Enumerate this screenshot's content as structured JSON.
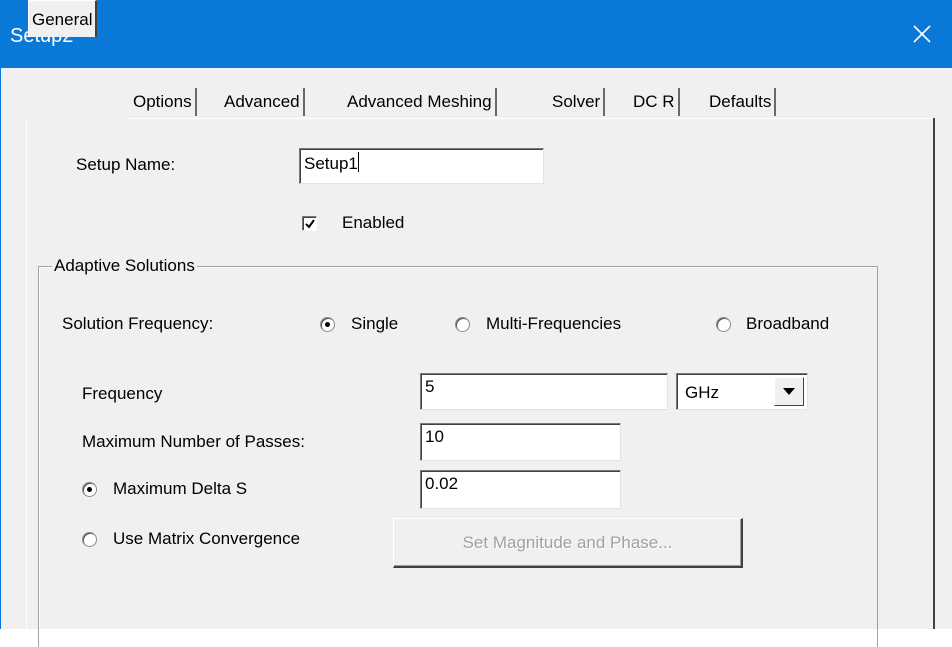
{
  "window": {
    "title": "Setup2",
    "accent_color": "#0a78d7"
  },
  "tabs": [
    {
      "label": "General",
      "active": true
    },
    {
      "label": "Options",
      "active": false
    },
    {
      "label": "Advanced",
      "active": false
    },
    {
      "label": "Advanced Meshing",
      "active": false
    },
    {
      "label": "Solver",
      "active": false
    },
    {
      "label": "DC R",
      "active": false
    },
    {
      "label": "Defaults",
      "active": false
    }
  ],
  "general": {
    "setup_name_label": "Setup Name:",
    "setup_name_value": "Setup1",
    "enabled_label": "Enabled",
    "enabled_checked": true
  },
  "adaptive": {
    "group_label": "Adaptive Solutions",
    "solution_frequency_label": "Solution Frequency:",
    "freq_options": [
      {
        "label": "Single",
        "selected": true
      },
      {
        "label": "Multi-Frequencies",
        "selected": false
      },
      {
        "label": "Broadband",
        "selected": false
      }
    ],
    "frequency_label": "Frequency",
    "frequency_value": "5",
    "frequency_unit": "GHz",
    "max_passes_label": "Maximum Number of Passes:",
    "max_passes_value": "10",
    "max_delta_s_label": "Maximum Delta S",
    "max_delta_s_selected": true,
    "max_delta_s_value": "0.02",
    "matrix_convergence_label": "Use Matrix Convergence",
    "matrix_convergence_selected": false,
    "set_magnitude_button": "Set Magnitude and Phase..."
  }
}
